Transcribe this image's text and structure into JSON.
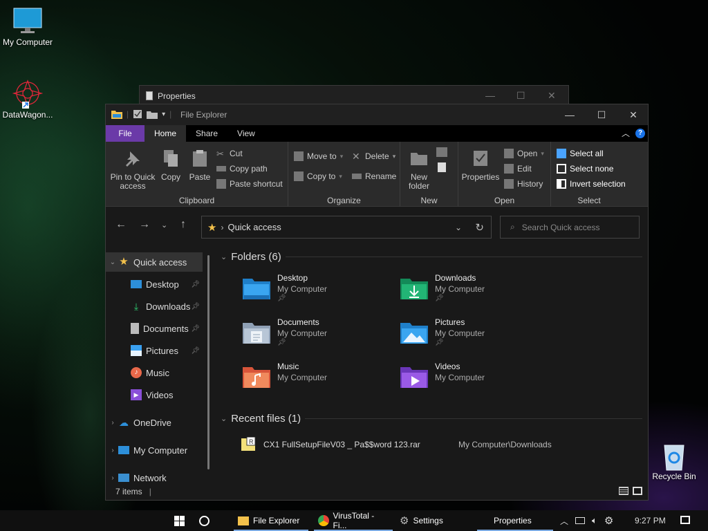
{
  "desktop": {
    "icons": [
      {
        "label": "My Computer"
      },
      {
        "label": "DataWagon..."
      },
      {
        "label": "Recycle Bin"
      }
    ]
  },
  "properties_window": {
    "title": "Properties"
  },
  "explorer": {
    "title": "File Explorer",
    "tabs": {
      "file": "File",
      "home": "Home",
      "share": "Share",
      "view": "View"
    },
    "ribbon": {
      "clipboard": {
        "pin_line1": "Pin to Quick",
        "pin_line2": "access",
        "copy": "Copy",
        "paste": "Paste",
        "cut": "Cut",
        "copy_path": "Copy path",
        "paste_shortcut": "Paste shortcut",
        "label": "Clipboard"
      },
      "organize": {
        "move_to": "Move to",
        "copy_to": "Copy to",
        "delete": "Delete",
        "rename": "Rename",
        "label": "Organize"
      },
      "new": {
        "new_folder_line1": "New",
        "new_folder_line2": "folder",
        "label": "New"
      },
      "open": {
        "properties": "Properties",
        "open": "Open",
        "edit": "Edit",
        "history": "History",
        "label": "Open"
      },
      "select": {
        "select_all": "Select all",
        "select_none": "Select none",
        "invert": "Invert selection",
        "label": "Select"
      }
    },
    "address": {
      "path": "Quick access",
      "search_placeholder": "Search Quick access"
    },
    "nav": [
      {
        "label": "Quick access"
      },
      {
        "label": "Desktop"
      },
      {
        "label": "Downloads"
      },
      {
        "label": "Documents"
      },
      {
        "label": "Pictures"
      },
      {
        "label": "Music"
      },
      {
        "label": "Videos"
      },
      {
        "label": "OneDrive"
      },
      {
        "label": "My Computer"
      },
      {
        "label": "Network"
      }
    ],
    "folders_header": "Folders (6)",
    "folders": [
      {
        "name": "Desktop",
        "location": "My Computer"
      },
      {
        "name": "Downloads",
        "location": "My Computer"
      },
      {
        "name": "Documents",
        "location": "My Computer"
      },
      {
        "name": "Pictures",
        "location": "My Computer"
      },
      {
        "name": "Music",
        "location": "My Computer"
      },
      {
        "name": "Videos",
        "location": "My Computer"
      }
    ],
    "recent_header": "Recent files (1)",
    "recent": [
      {
        "name": "CX1 FullSetupFileV03 _ Pa$$word 123.rar",
        "location": "My Computer\\Downloads"
      }
    ],
    "status": "7 items"
  },
  "taskbar": {
    "apps": [
      {
        "label": "File Explorer"
      },
      {
        "label": "VirusTotal - Fi..."
      },
      {
        "label": "Settings"
      },
      {
        "label": "Properties"
      }
    ],
    "clock": "9:27 PM"
  },
  "colors": {
    "file_tab": "#6b3aa8",
    "help": "#1a73e8",
    "folder_blue": "#2d8fd9",
    "folder_green": "#1fa36a"
  }
}
